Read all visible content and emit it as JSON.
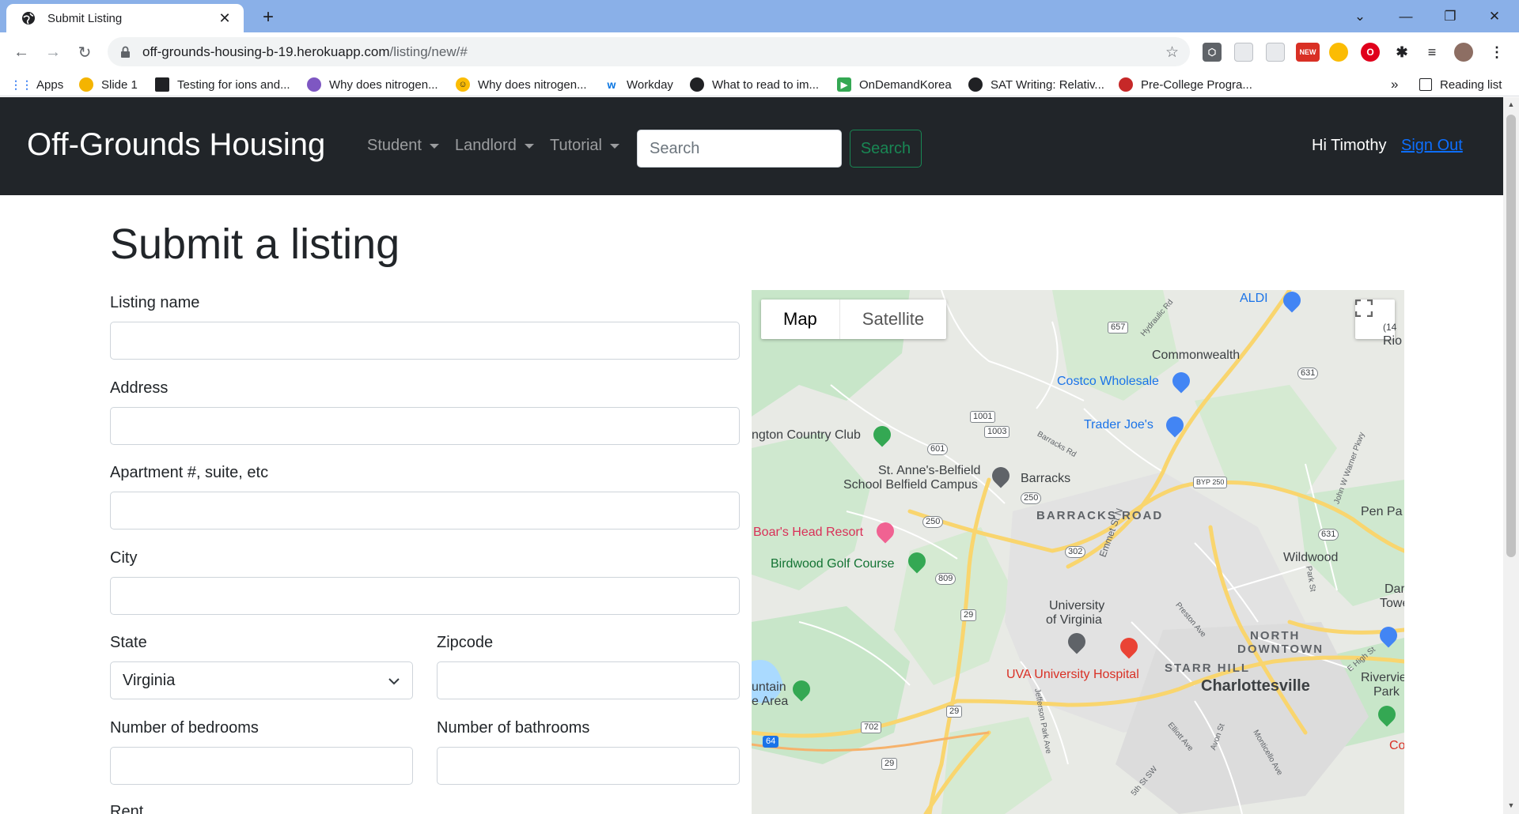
{
  "browser": {
    "tab_title": "Submit Listing",
    "url_host": "off-grounds-housing-b-19.herokuapp.com",
    "url_path": "/listing/new/#",
    "bookmarks": [
      {
        "label": "Apps",
        "icon": "apps-grid-icon"
      },
      {
        "label": "Slide 1",
        "icon": "slide-icon"
      },
      {
        "label": "Testing for ions and...",
        "icon": "video-icon"
      },
      {
        "label": "Why does nitrogen...",
        "icon": "people-icon"
      },
      {
        "label": "Why does nitrogen...",
        "icon": "smiley-icon"
      },
      {
        "label": "Workday",
        "icon": "workday-icon"
      },
      {
        "label": "What to read to im...",
        "icon": "globe-icon"
      },
      {
        "label": "OnDemandKorea",
        "icon": "play-icon"
      },
      {
        "label": "SAT Writing: Relativ...",
        "icon": "globe-icon"
      },
      {
        "label": "Pre-College Progra...",
        "icon": "college-icon"
      }
    ],
    "overflow_label": "»",
    "reading_list": "Reading list",
    "new_badge": "NEW"
  },
  "navbar": {
    "brand": "Off-Grounds Housing",
    "menus": [
      "Student",
      "Landlord",
      "Tutorial"
    ],
    "search_placeholder": "Search",
    "search_button": "Search",
    "greeting": "Hi Timothy",
    "signout": "Sign Out"
  },
  "form": {
    "title": "Submit a listing",
    "listing_name_label": "Listing name",
    "address_label": "Address",
    "apartment_label": "Apartment #, suite, etc",
    "city_label": "City",
    "state_label": "State",
    "state_value": "Virginia",
    "zipcode_label": "Zipcode",
    "bedrooms_label": "Number of bedrooms",
    "bathrooms_label": "Number of bathrooms",
    "rent_label": "Rent"
  },
  "map": {
    "type_map": "Map",
    "type_satellite": "Satellite",
    "labels": {
      "aldi": "ALDI",
      "commonwealth": "Commonwealth",
      "costco": "Costco Wholesale",
      "trader_joes": "Trader Joe's",
      "country_club": "ngton Country Club",
      "st_annes_1": "St. Anne's-Belfield",
      "st_annes_2": "School Belfield Campus",
      "barracks": "Barracks",
      "barracks_road": "BARRACKS ROAD",
      "boars_head": "Boar's Head Resort",
      "birdwood": "Birdwood Golf Course",
      "uva_1": "University",
      "uva_2": "of Virginia",
      "uva_hospital": "UVA University Hospital",
      "north_downtown_1": "NORTH",
      "north_downtown_2": "DOWNTOWN",
      "starr_hill": "STARR HILL",
      "charlottesville": "Charlottesville",
      "wildwood": "Wildwood",
      "pen_park": "Pen Pa",
      "rivervie_1": "Riverview",
      "rivervie_2": "Park",
      "dar_1": "Dar",
      "dar_2": "Towe",
      "co": "Co",
      "rio_1": "(14",
      "rio_2": "Rio",
      "mountain_1": "untain",
      "mountain_2": "e Area",
      "emmet": "Emmet St N",
      "barracks_rd_small": "Barracks Rd",
      "hydraulic": "Hydraulic Rd",
      "preston": "Preston Ave",
      "jefferson": "Jefferson Park Ave",
      "elliott": "Elliott Ave",
      "avon": "Avon St",
      "monticello": "Monticello Ave",
      "high_st": "E High St",
      "fifth_st": "5th St SW",
      "park_st": "Park St",
      "warner": "John W Warner Pkwy"
    },
    "shields": [
      "657",
      "631",
      "1001",
      "1003",
      "601",
      "250",
      "BYP 250",
      "250",
      "302",
      "631",
      "809",
      "29",
      "29",
      "702",
      "29",
      "64"
    ]
  }
}
